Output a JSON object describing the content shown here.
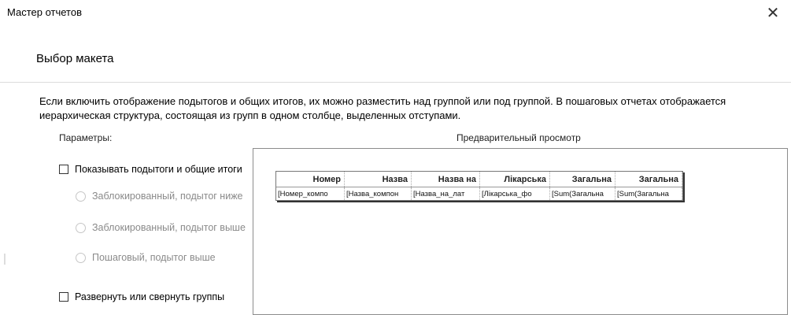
{
  "window": {
    "title": "Мастер отчетов"
  },
  "section": {
    "title": "Выбор макета"
  },
  "description": "Если включить отображение подытогов и общих итогов, их можно разместить над группой или под группой. В пошаговых отчетах отображается иерархическая структура, состоящая из групп в одном столбце, выделенных отступами.",
  "params": {
    "label": "Параметры:",
    "show_totals": {
      "label": "Показывать подытоги и общие итоги",
      "checked": false
    },
    "radios": [
      {
        "label": "Заблокированный, подытог ниже",
        "enabled": false
      },
      {
        "label": "Заблокированный, подытог выше",
        "enabled": false
      },
      {
        "label": "Пошаговый, подытог выше",
        "enabled": false
      }
    ],
    "expand_groups": {
      "label": "Развернуть или свернуть группы",
      "checked": false
    }
  },
  "preview": {
    "label": "Предварительный просмотр",
    "headers": [
      "Номер",
      "Назва",
      "Назва на",
      "Лікарська",
      "Загальна",
      "Загальна"
    ],
    "cells": [
      "[Номер_компо",
      "[Назва_компон",
      "[Назва_на_лат",
      "[Лікарська_фо",
      "[Sum(Загальна",
      "[Sum(Загальна"
    ]
  }
}
